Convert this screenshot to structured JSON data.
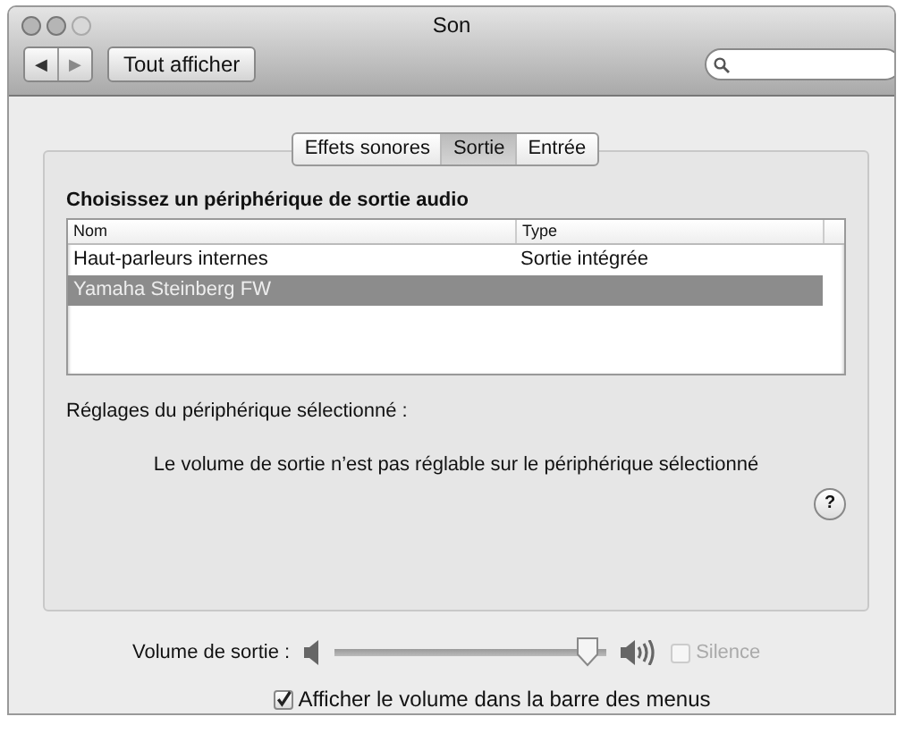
{
  "window": {
    "title": "Son"
  },
  "toolbar": {
    "back": {
      "label": "◀",
      "disabled": false
    },
    "forward": {
      "label": "▶",
      "disabled": true
    },
    "show_all": "Tout afficher"
  },
  "tabs": [
    {
      "label": "Effets sonores",
      "selected": false
    },
    {
      "label": "Sortie",
      "selected": true
    },
    {
      "label": "Entrée",
      "selected": false
    }
  ],
  "heading": "Choisissez un périphérique de sortie audio",
  "table": {
    "columns": [
      "Nom",
      "Type"
    ],
    "rows": [
      {
        "cells": [
          "Haut-parleurs internes",
          "Sortie intégrée"
        ],
        "selected": false
      },
      {
        "cells": [
          "Yamaha Steinberg FW",
          ""
        ],
        "selected": true
      }
    ]
  },
  "settings_label": "Réglages du périphérique sélectionné :",
  "message": "Le volume de sortie n’est pas réglable sur le périphérique sélectionné",
  "help": "?",
  "volume": {
    "label": "Volume de sortie :",
    "level": 0.97,
    "silence": {
      "label": "Silence",
      "checked": false,
      "disabled": true
    }
  },
  "menubar_option": {
    "label": "Afficher le volume dans la barre des menus",
    "checked": true
  }
}
